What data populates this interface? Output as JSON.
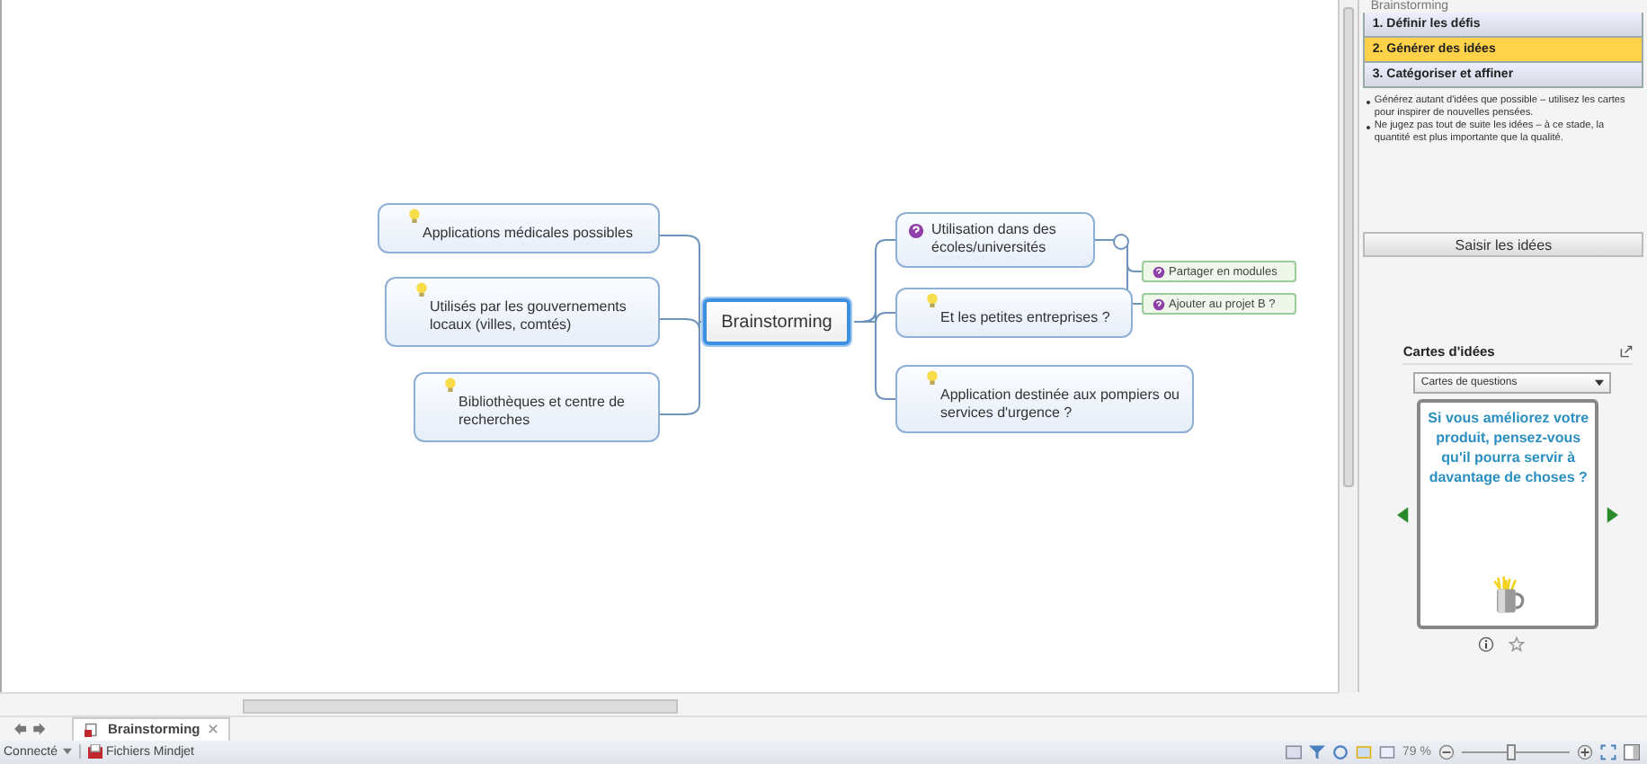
{
  "map": {
    "central": {
      "label": "Brainstorming",
      "selected": true
    },
    "left_branches": [
      {
        "label": "Applications médicales possibles",
        "kind": "idea"
      },
      {
        "label": "Utilisés par les gouvernements locaux (villes, comtés)",
        "kind": "idea"
      },
      {
        "label": "Bibliothèques et centre de recherches",
        "kind": "idea"
      }
    ],
    "right_branches": [
      {
        "label": "Utilisation dans des écoles/universités",
        "kind": "question",
        "children": [
          {
            "label": "Partager en modules",
            "kind": "question"
          },
          {
            "label": "Ajouter au projet B ?",
            "kind": "question"
          }
        ]
      },
      {
        "label": "Et les petites entreprises ?",
        "kind": "idea"
      },
      {
        "label": "Application destinée aux pompiers ou services d'urgence ?",
        "kind": "idea"
      }
    ]
  },
  "side_panel": {
    "title": "Brainstorming",
    "steps": [
      {
        "label": "1. Définir les défis",
        "selected": false
      },
      {
        "label": "2. Générer des idées",
        "selected": true
      },
      {
        "label": "3. Catégoriser et affiner",
        "selected": false
      }
    ],
    "tips": [
      "Générez autant d'idées que possible – utilisez les cartes pour inspirer de nouvelles pensées.",
      "Ne jugez pas tout de suite les idées – à ce stade, la quantité est plus importante que la qualité."
    ],
    "action_button": "Saisir les idées",
    "cards_title": "Cartes d'idées",
    "deck_select": "Cartes de questions",
    "card_text": "Si vous améliorez votre produit, pensez-vous qu'il pourra servir à davantage de choses ?"
  },
  "document_tabs": [
    {
      "label": "Brainstorming",
      "selected": true
    }
  ],
  "status_bar": {
    "connection": "Connecté",
    "files": "Fichiers Mindjet",
    "zoom": "79 %",
    "zoom_slider": {
      "level": 0.45
    }
  }
}
